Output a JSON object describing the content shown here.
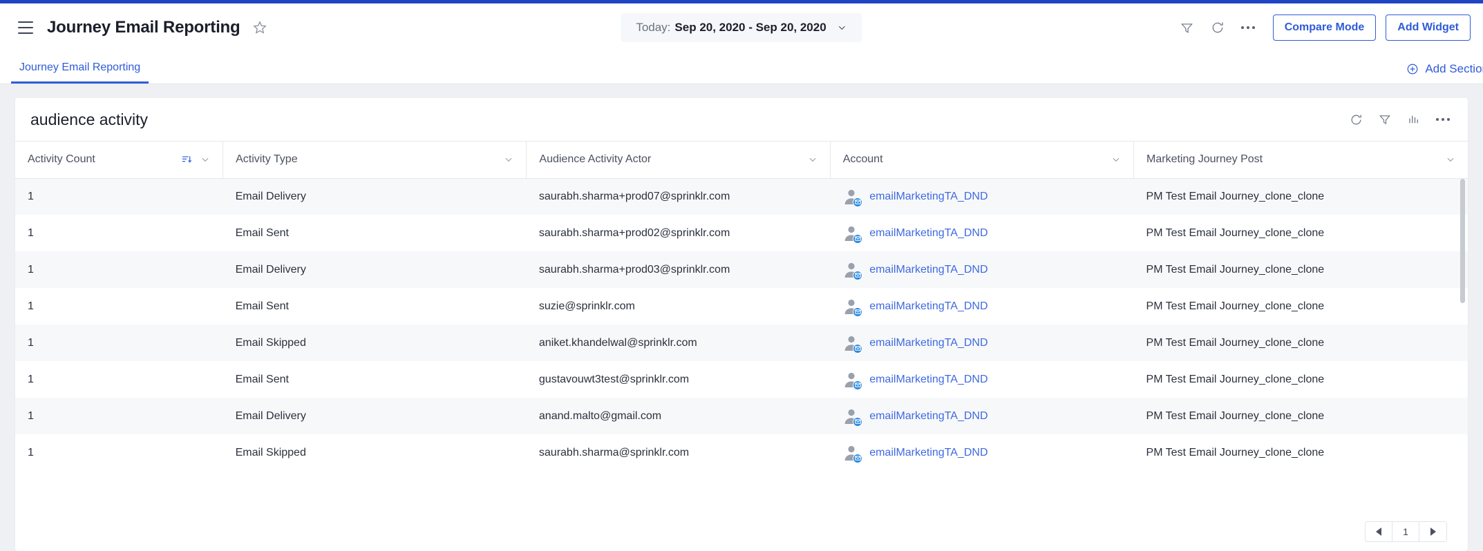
{
  "theme": {
    "accent_blue": "#2f5bd8",
    "top_accent": "#1f45c4",
    "link_blue": "#3f6ae0",
    "canvas_bg": "#eef0f3",
    "row_alt_bg": "#f7f8fa"
  },
  "topbar": {
    "menu_icon": "hamburger-icon",
    "title": "Journey Email Reporting",
    "favorite_icon": "star-icon",
    "daterange": {
      "label": "Today:",
      "value": "Sep 20, 2020 - Sep 20, 2020",
      "chevron_icon": "chevron-down-icon"
    },
    "filter_icon": "filter-icon",
    "refresh_icon": "refresh-icon",
    "more_icon": "ellipsis-icon",
    "compare_mode_label": "Compare Mode",
    "add_widget_label": "Add Widget"
  },
  "tabbar": {
    "tabs": [
      {
        "label": "Journey Email Reporting",
        "active": true
      }
    ],
    "add_section_label": "Add Section",
    "add_section_icon": "plus-circle-icon"
  },
  "widget": {
    "title": "audience activity",
    "actions": [
      {
        "icon": "refresh-icon"
      },
      {
        "icon": "filter-icon"
      },
      {
        "icon": "bar-chart-icon"
      },
      {
        "icon": "ellipsis-icon"
      }
    ],
    "columns": [
      {
        "label": "Activity Count",
        "sorted": true,
        "sort_icon": "sort-descending-icon",
        "chevron_icon": "chevron-down-icon"
      },
      {
        "label": "Activity Type",
        "sorted": false,
        "chevron_icon": "chevron-down-icon"
      },
      {
        "label": "Audience Activity Actor",
        "sorted": false,
        "chevron_icon": "chevron-down-icon"
      },
      {
        "label": "Account",
        "sorted": false,
        "chevron_icon": "chevron-down-icon"
      },
      {
        "label": "Marketing Journey Post",
        "sorted": false,
        "chevron_icon": "chevron-down-icon"
      }
    ],
    "rows": [
      {
        "activity_count": "1",
        "activity_type": "Email Delivery",
        "actor": "saurabh.sharma+prod07@sprinklr.com",
        "account": "emailMarketingTA_DND",
        "account_avatar_icon": "user-avatar-email-icon",
        "journey_post": "PM Test Email Journey_clone_clone"
      },
      {
        "activity_count": "1",
        "activity_type": "Email Sent",
        "actor": "saurabh.sharma+prod02@sprinklr.com",
        "account": "emailMarketingTA_DND",
        "account_avatar_icon": "user-avatar-email-icon",
        "journey_post": "PM Test Email Journey_clone_clone"
      },
      {
        "activity_count": "1",
        "activity_type": "Email Delivery",
        "actor": "saurabh.sharma+prod03@sprinklr.com",
        "account": "emailMarketingTA_DND",
        "account_avatar_icon": "user-avatar-email-icon",
        "journey_post": "PM Test Email Journey_clone_clone"
      },
      {
        "activity_count": "1",
        "activity_type": "Email Sent",
        "actor": "suzie@sprinklr.com",
        "account": "emailMarketingTA_DND",
        "account_avatar_icon": "user-avatar-email-icon",
        "journey_post": "PM Test Email Journey_clone_clone"
      },
      {
        "activity_count": "1",
        "activity_type": "Email Skipped",
        "actor": "aniket.khandelwal@sprinklr.com",
        "account": "emailMarketingTA_DND",
        "account_avatar_icon": "user-avatar-email-icon",
        "journey_post": "PM Test Email Journey_clone_clone"
      },
      {
        "activity_count": "1",
        "activity_type": "Email Sent",
        "actor": "gustavouwt3test@sprinklr.com",
        "account": "emailMarketingTA_DND",
        "account_avatar_icon": "user-avatar-email-icon",
        "journey_post": "PM Test Email Journey_clone_clone"
      },
      {
        "activity_count": "1",
        "activity_type": "Email Delivery",
        "actor": "anand.malto@gmail.com",
        "account": "emailMarketingTA_DND",
        "account_avatar_icon": "user-avatar-email-icon",
        "journey_post": "PM Test Email Journey_clone_clone"
      },
      {
        "activity_count": "1",
        "activity_type": "Email Skipped",
        "actor": "saurabh.sharma@sprinklr.com",
        "account": "emailMarketingTA_DND",
        "account_avatar_icon": "user-avatar-email-icon",
        "journey_post": "PM Test Email Journey_clone_clone"
      }
    ],
    "pagination": {
      "prev_icon": "triangle-left-icon",
      "page": "1",
      "next_icon": "triangle-right-icon"
    }
  }
}
